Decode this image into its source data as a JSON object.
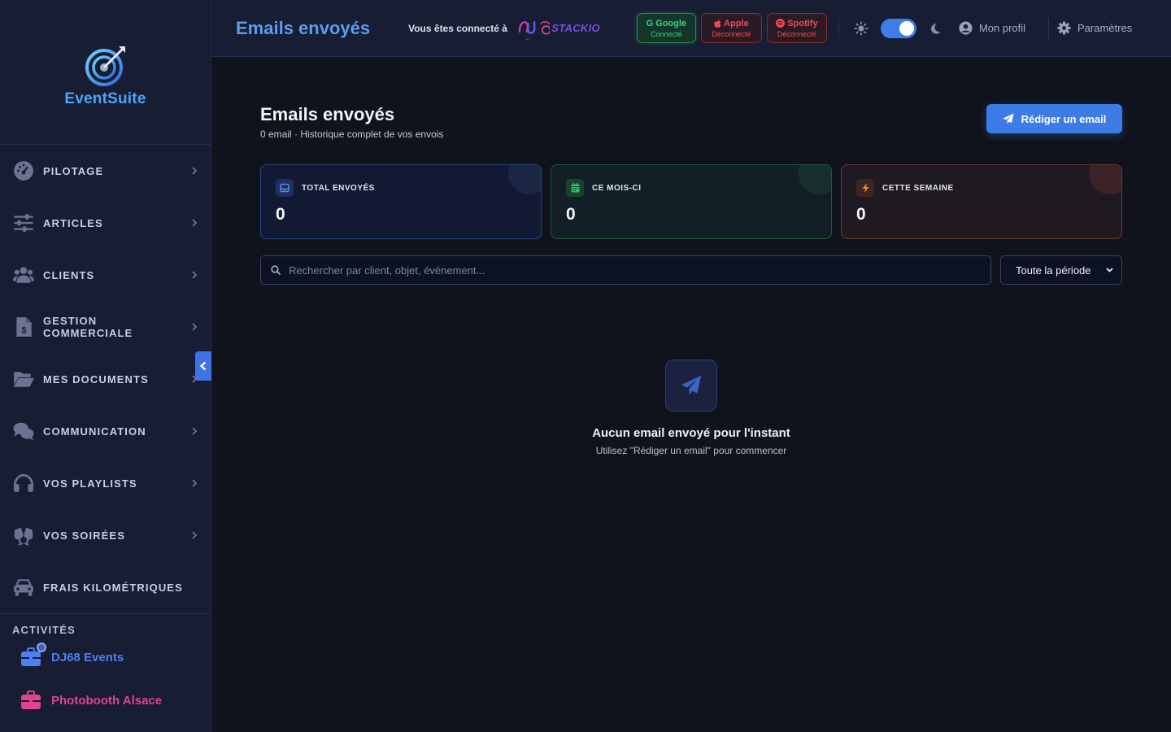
{
  "app": {
    "name": "EventSuite"
  },
  "sidebar": {
    "items": [
      {
        "label": "PILOTAGE",
        "icon": "gauge-icon"
      },
      {
        "label": "ARTICLES",
        "icon": "sliders-icon"
      },
      {
        "label": "CLIENTS",
        "icon": "users-icon"
      },
      {
        "label": "GESTION COMMERCIALE",
        "icon": "invoice-dollar-icon"
      },
      {
        "label": "MES DOCUMENTS",
        "icon": "folder-open-icon"
      },
      {
        "label": "COMMUNICATION",
        "icon": "comments-icon"
      },
      {
        "label": "VOS PLAYLISTS",
        "icon": "headphones-icon"
      },
      {
        "label": "VOS SOIRÉES",
        "icon": "glass-cheers-icon"
      },
      {
        "label": "FRAIS KILOMÉTRIQUES",
        "icon": "car-icon"
      }
    ],
    "activities_title": "ACTIVITÉS",
    "activities": [
      {
        "label": "DJ68 Events",
        "color": "#4f7ff0"
      },
      {
        "label": "Photobooth Alsace",
        "color": "#e0458c"
      }
    ]
  },
  "topbar": {
    "page_heading": "Emails envoyés",
    "connected_text": "Vous êtes connecté à",
    "partner_logo_text": "STACKIO",
    "services": [
      {
        "name": "Google",
        "status": "Connecté"
      },
      {
        "name": "Apple",
        "status": "Déconnecté"
      },
      {
        "name": "Spotify",
        "status": "Déconnecté"
      }
    ],
    "dark_mode_on": true,
    "profile_label": "Mon profil",
    "settings_label": "Paramètres"
  },
  "main": {
    "title": "Emails envoyés",
    "subtitle": "0 email · Historique complet de vos envois",
    "compose_label": "Rédiger un email",
    "stats": [
      {
        "label": "TOTAL ENVOYÉS",
        "value": "0"
      },
      {
        "label": "CE MOIS-CI",
        "value": "0"
      },
      {
        "label": "CETTE SEMAINE",
        "value": "0"
      }
    ],
    "search_placeholder": "Rechercher par client, objet, événement...",
    "period_selected": "Toute la période",
    "empty_title": "Aucun email envoyé pour l'instant",
    "empty_subtitle": "Utilisez \"Rédiger un email\" pour commencer"
  },
  "colors": {
    "accent": "#3d7be6",
    "heading_blue": "#5b9cf0",
    "connected_green": "#3fd079",
    "disconnected_red": "#ef4a55"
  }
}
